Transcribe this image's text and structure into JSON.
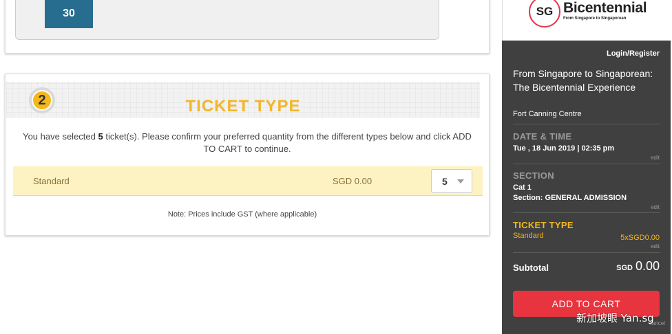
{
  "calendar": {
    "day": "30"
  },
  "ticket_type": {
    "step_number": "2",
    "title": "TICKET TYPE",
    "desc_prefix": "You have selected ",
    "ticket_count": "5",
    "desc_suffix": " ticket(s). Please confirm your preferred quantity from the different types below and click ADD TO CART to continue.",
    "row": {
      "name": "Standard",
      "price": "SGD 0.00",
      "quantity": "5"
    },
    "note": "Note: Prices include GST (where applicable)"
  },
  "sidebar": {
    "logo": {
      "mark": "SG",
      "name": "Bicentennial",
      "tagline": "From Singapore to Singaporean"
    },
    "login": "Login/Register",
    "event_title": "From Singapore to Singaporean: The Bicentennial Experience",
    "venue": "Fort Canning Centre",
    "datetime_label": "DATE & TIME",
    "datetime_value": "Tue , 18 Jun 2019 | 02:35 pm",
    "section_label": "SECTION",
    "section_cat": "Cat 1",
    "section_value": "Section: GENERAL ADMISSION",
    "tickettype_label": "TICKET TYPE",
    "tickettype_value": "Standard",
    "tickettype_price": "5xSGD0.00",
    "edit": "edit",
    "subtotal_label": "Subtotal",
    "subtotal_currency": "SGD",
    "subtotal_amount": "0.00",
    "cart_button": "ADD TO CART",
    "cancel": "cancel"
  },
  "watermark": "新加坡眼 Yan.sg",
  "colors": {
    "accent_yellow": "#f5b81c",
    "cart_red": "#e8343f",
    "sidebar_bg": "#404040",
    "calendar_blue": "#276d8f"
  }
}
